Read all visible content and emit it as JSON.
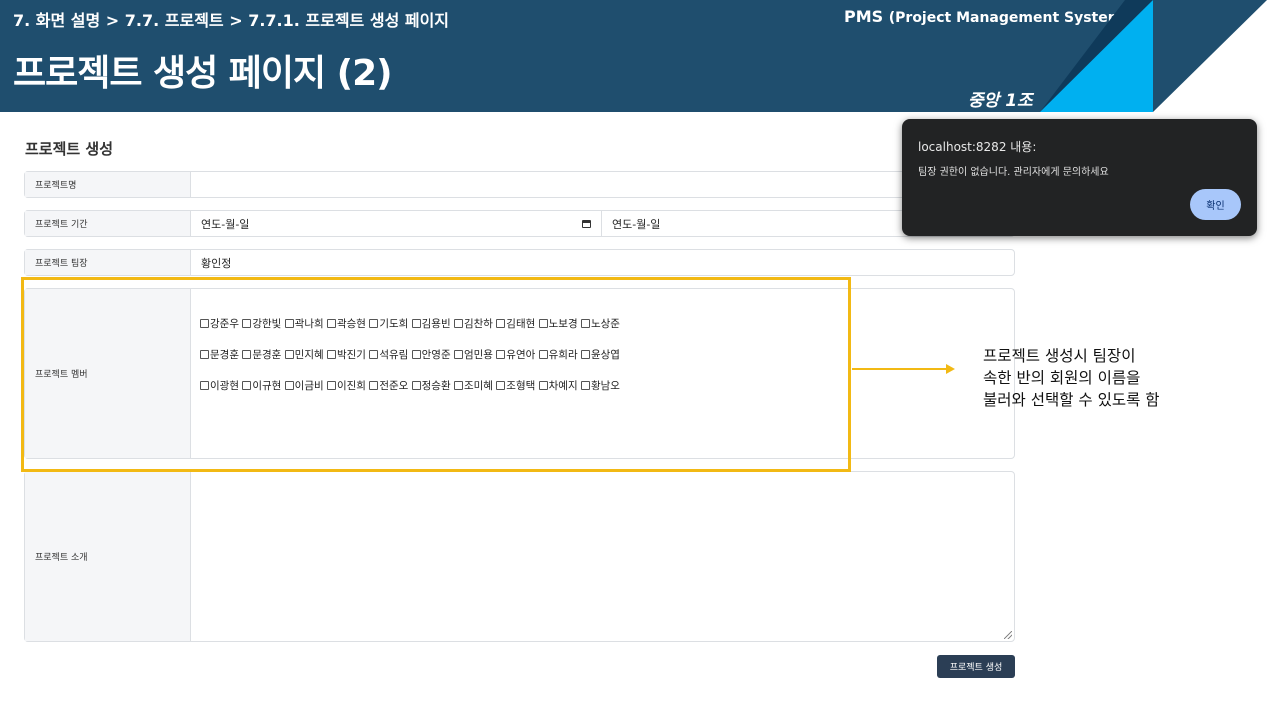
{
  "header": {
    "breadcrumb": "7. 화면 설명 > 7.7. 프로젝트 > 7.7.1. 프로젝트 생성 페이지",
    "title": "프로젝트 생성 페이지 (2)",
    "system_name": "PMS",
    "system_full": "(Project Management System)",
    "team": "중앙 1조"
  },
  "colors": {
    "header_bg": "#1f4e6e",
    "accent_blue": "#00b0f0",
    "highlight": "#f2b914",
    "submit_bg": "#2b3e55"
  },
  "form": {
    "title": "프로젝트 생성",
    "name_label": "프로젝트명",
    "name_value": "",
    "period_label": "프로젝트 기간",
    "start_date": "연도-월-일",
    "end_date": "연도-월-일",
    "leader_label": "프로젝트 팀장",
    "leader_value": "황인정",
    "members_label": "프로젝트 멤버",
    "members": [
      [
        "강준우",
        "강한빛",
        "곽나희",
        "곽승현",
        "기도희",
        "김용빈",
        "김찬하",
        "김태현",
        "노보경",
        "노상준"
      ],
      [
        "문경훈",
        "문경훈",
        "민지혜",
        "박진기",
        "석유림",
        "안영준",
        "엄민용",
        "유연아",
        "유희라",
        "윤상엽"
      ],
      [
        "이광현",
        "이규현",
        "이금비",
        "이진희",
        "전준오",
        "정승환",
        "조미혜",
        "조형택",
        "차예지",
        "황남오"
      ]
    ],
    "intro_label": "프로젝트 소개",
    "intro_value": "",
    "submit_label": "프로젝트 생성"
  },
  "annotation": {
    "lines": [
      "프로젝트 생성시 팀장이",
      "속한 반의 회원의 이름을",
      "불러와 선택할 수 있도록 함"
    ]
  },
  "dialog": {
    "title": "localhost:8282 내용:",
    "message": "팀장 권한이 없습니다. 관리자에게 문의하세요",
    "ok_label": "확인"
  }
}
